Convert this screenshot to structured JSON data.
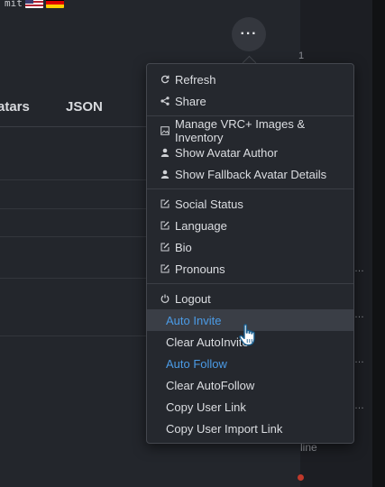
{
  "header": {
    "lang_text": "mit"
  },
  "tabs": [
    {
      "label": "atars"
    },
    {
      "label": "JSON"
    }
  ],
  "more_button": {
    "icon": "ellipsis-icon",
    "glyph": "···"
  },
  "side": {
    "glyph_top": "1",
    "dots": "…",
    "online_text": "line"
  },
  "menu": {
    "groups": [
      [
        {
          "label": "Refresh",
          "icon": "refresh-icon"
        },
        {
          "label": "Share",
          "icon": "share-icon"
        }
      ],
      [
        {
          "label": "Manage VRC+ Images & Inventory",
          "icon": "image-icon"
        },
        {
          "label": "Show Avatar Author",
          "icon": "user-icon"
        },
        {
          "label": "Show Fallback Avatar Details",
          "icon": "user-icon"
        }
      ],
      [
        {
          "label": "Social Status",
          "icon": "edit-icon"
        },
        {
          "label": "Language",
          "icon": "edit-icon"
        },
        {
          "label": "Bio",
          "icon": "edit-icon"
        },
        {
          "label": "Pronouns",
          "icon": "edit-icon"
        }
      ],
      [
        {
          "label": "Logout",
          "icon": "power-icon"
        },
        {
          "label": "Auto Invite",
          "active": true,
          "hover": true
        },
        {
          "label": "Clear AutoInvite"
        },
        {
          "label": "Auto Follow",
          "active": true
        },
        {
          "label": "Clear AutoFollow"
        },
        {
          "label": "Copy User Link"
        },
        {
          "label": "Copy User Import Link"
        }
      ]
    ]
  },
  "colors": {
    "accent": "#4b9be6",
    "menu_bg": "#25282e",
    "hover_bg": "#3a3e46"
  }
}
